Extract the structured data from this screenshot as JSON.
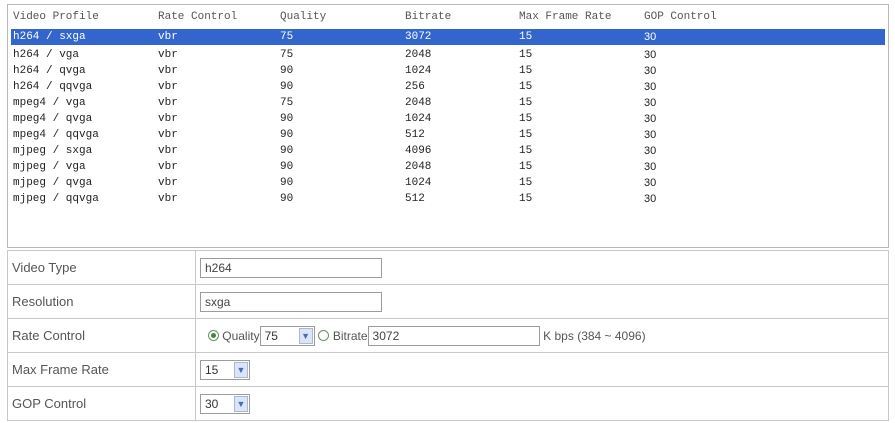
{
  "columns": [
    "Video Profile",
    "Rate Control",
    "Quality",
    "Bitrate",
    "Max Frame Rate",
    "GOP Control"
  ],
  "profiles": [
    {
      "profile": "h264 / sxga",
      "rate_control": "vbr",
      "quality": "75",
      "bitrate": "3072",
      "max_frame_rate": "15",
      "gop": "30"
    },
    {
      "profile": "h264 / vga",
      "rate_control": "vbr",
      "quality": "75",
      "bitrate": "2048",
      "max_frame_rate": "15",
      "gop": "30"
    },
    {
      "profile": "h264 / qvga",
      "rate_control": "vbr",
      "quality": "90",
      "bitrate": "1024",
      "max_frame_rate": "15",
      "gop": "30"
    },
    {
      "profile": "h264 / qqvga",
      "rate_control": "vbr",
      "quality": "90",
      "bitrate": "256",
      "max_frame_rate": "15",
      "gop": "30"
    },
    {
      "profile": "mpeg4 / vga",
      "rate_control": "vbr",
      "quality": "75",
      "bitrate": "2048",
      "max_frame_rate": "15",
      "gop": "30"
    },
    {
      "profile": "mpeg4 / qvga",
      "rate_control": "vbr",
      "quality": "90",
      "bitrate": "1024",
      "max_frame_rate": "15",
      "gop": "30"
    },
    {
      "profile": "mpeg4 / qqvga",
      "rate_control": "vbr",
      "quality": "90",
      "bitrate": "512",
      "max_frame_rate": "15",
      "gop": "30"
    },
    {
      "profile": "mjpeg / sxga",
      "rate_control": "vbr",
      "quality": "90",
      "bitrate": "4096",
      "max_frame_rate": "15",
      "gop": "30"
    },
    {
      "profile": "mjpeg / vga",
      "rate_control": "vbr",
      "quality": "90",
      "bitrate": "2048",
      "max_frame_rate": "15",
      "gop": "30"
    },
    {
      "profile": "mjpeg / qvga",
      "rate_control": "vbr",
      "quality": "90",
      "bitrate": "1024",
      "max_frame_rate": "15",
      "gop": "30"
    },
    {
      "profile": "mjpeg / qqvga",
      "rate_control": "vbr",
      "quality": "90",
      "bitrate": "512",
      "max_frame_rate": "15",
      "gop": "30"
    }
  ],
  "selected_index": 0,
  "selection_color": "#3366cc",
  "form": {
    "video_type": {
      "label": "Video Type",
      "value": "h264"
    },
    "resolution": {
      "label": "Resolution",
      "value": "sxga"
    },
    "rate_control": {
      "label": "Rate Control",
      "quality_label": "Quality",
      "quality_value": "75",
      "bitrate_label": "Bitrate",
      "bitrate_value": "3072",
      "bitrate_range": "K bps (384 ~ 4096)",
      "selected_mode": "Quality"
    },
    "max_frame_rate": {
      "label": "Max Frame Rate",
      "value": "15"
    },
    "gop_control": {
      "label": "GOP Control",
      "value": "30"
    }
  }
}
